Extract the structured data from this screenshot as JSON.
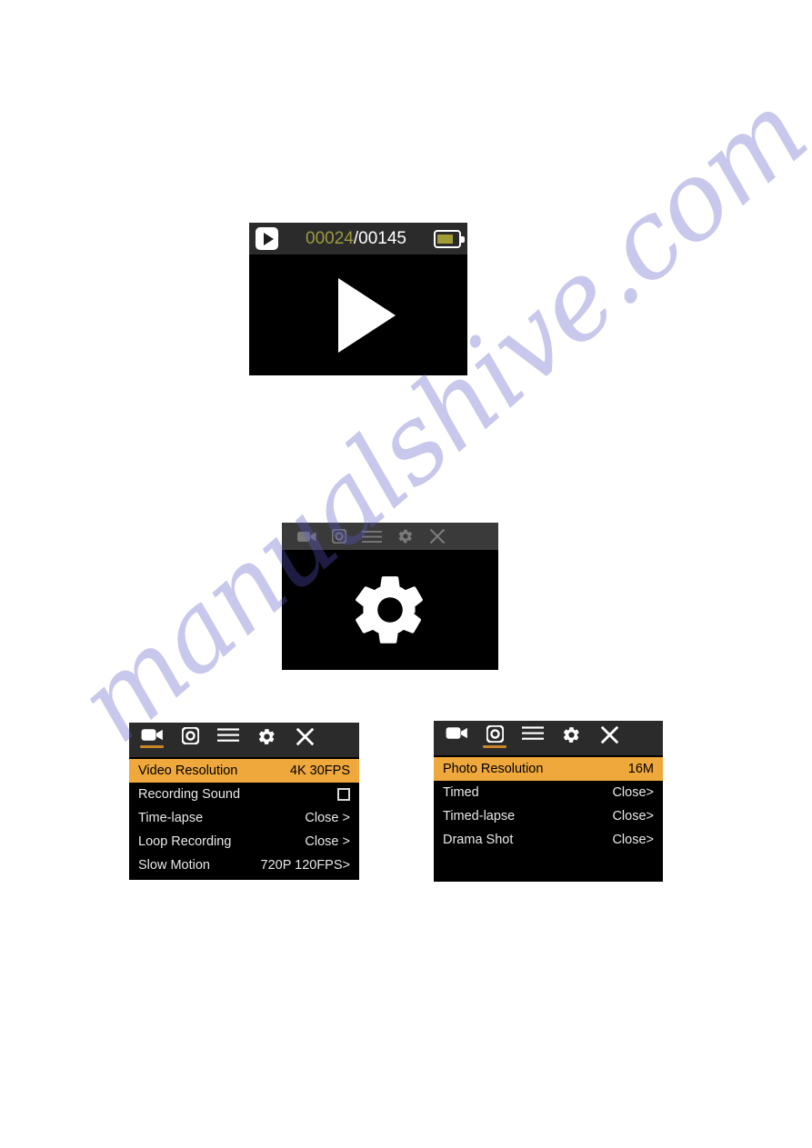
{
  "watermark": {
    "text": "manualshive.com",
    "color": "#5b57c8"
  },
  "colors": {
    "highlight_orange": "#efa83c",
    "tab_underline_orange": "#c8862a",
    "counter_current": "#9c9a3f",
    "battery_fill": "#a39b35",
    "screen_black": "#000000",
    "topbar_gray": "#2b2b2b",
    "inactive_icon_gray": "#7a7a7a"
  },
  "playback_screen": {
    "play_badge_icon": "play-icon",
    "counter": {
      "current": "00024",
      "separator": "/",
      "total": "00145"
    },
    "battery_icon": "battery-icon",
    "center_icon": "play-triangle-icon"
  },
  "settings_splash": {
    "toolbar": [
      {
        "icon": "video-camera-icon",
        "label": "Video",
        "active": false
      },
      {
        "icon": "photo-camera-icon",
        "label": "Photo",
        "active": false
      },
      {
        "icon": "hamburger-menu-icon",
        "label": "Playback",
        "active": false
      },
      {
        "icon": "gear-icon",
        "label": "Settings",
        "active": false
      },
      {
        "icon": "close-x-icon",
        "label": "Exit",
        "active": false
      }
    ],
    "center_icon": "gear-icon"
  },
  "video_menu": {
    "toolbar": [
      {
        "icon": "video-camera-icon",
        "label": "Video",
        "active": true
      },
      {
        "icon": "photo-camera-icon",
        "label": "Photo",
        "active": false
      },
      {
        "icon": "hamburger-menu-icon",
        "label": "Playback",
        "active": false
      },
      {
        "icon": "gear-icon",
        "label": "Settings",
        "active": false
      },
      {
        "icon": "close-x-icon",
        "label": "Exit",
        "active": false
      }
    ],
    "rows": [
      {
        "label": "Video Resolution",
        "value": "4K 30FPS",
        "highlight": true,
        "type": "value"
      },
      {
        "label": "Recording Sound",
        "value": "",
        "highlight": false,
        "type": "checkbox"
      },
      {
        "label": "Time-lapse",
        "value": "Close >",
        "highlight": false,
        "type": "value"
      },
      {
        "label": "Loop Recording",
        "value": "Close >",
        "highlight": false,
        "type": "value"
      },
      {
        "label": "Slow Motion",
        "value": "720P 120FPS>",
        "highlight": false,
        "type": "value"
      }
    ]
  },
  "photo_menu": {
    "toolbar": [
      {
        "icon": "video-camera-icon",
        "label": "Video",
        "active": false
      },
      {
        "icon": "photo-camera-icon",
        "label": "Photo",
        "active": true
      },
      {
        "icon": "hamburger-menu-icon",
        "label": "Playback",
        "active": false
      },
      {
        "icon": "gear-icon",
        "label": "Settings",
        "active": false
      },
      {
        "icon": "close-x-icon",
        "label": "Exit",
        "active": false
      }
    ],
    "rows": [
      {
        "label": "Photo Resolution",
        "value": "16M",
        "highlight": true,
        "type": "value"
      },
      {
        "label": "Timed",
        "value": "Close>",
        "highlight": false,
        "type": "value"
      },
      {
        "label": "Timed-lapse",
        "value": "Close>",
        "highlight": false,
        "type": "value"
      },
      {
        "label": "Drama Shot",
        "value": "Close>",
        "highlight": false,
        "type": "value"
      }
    ]
  }
}
